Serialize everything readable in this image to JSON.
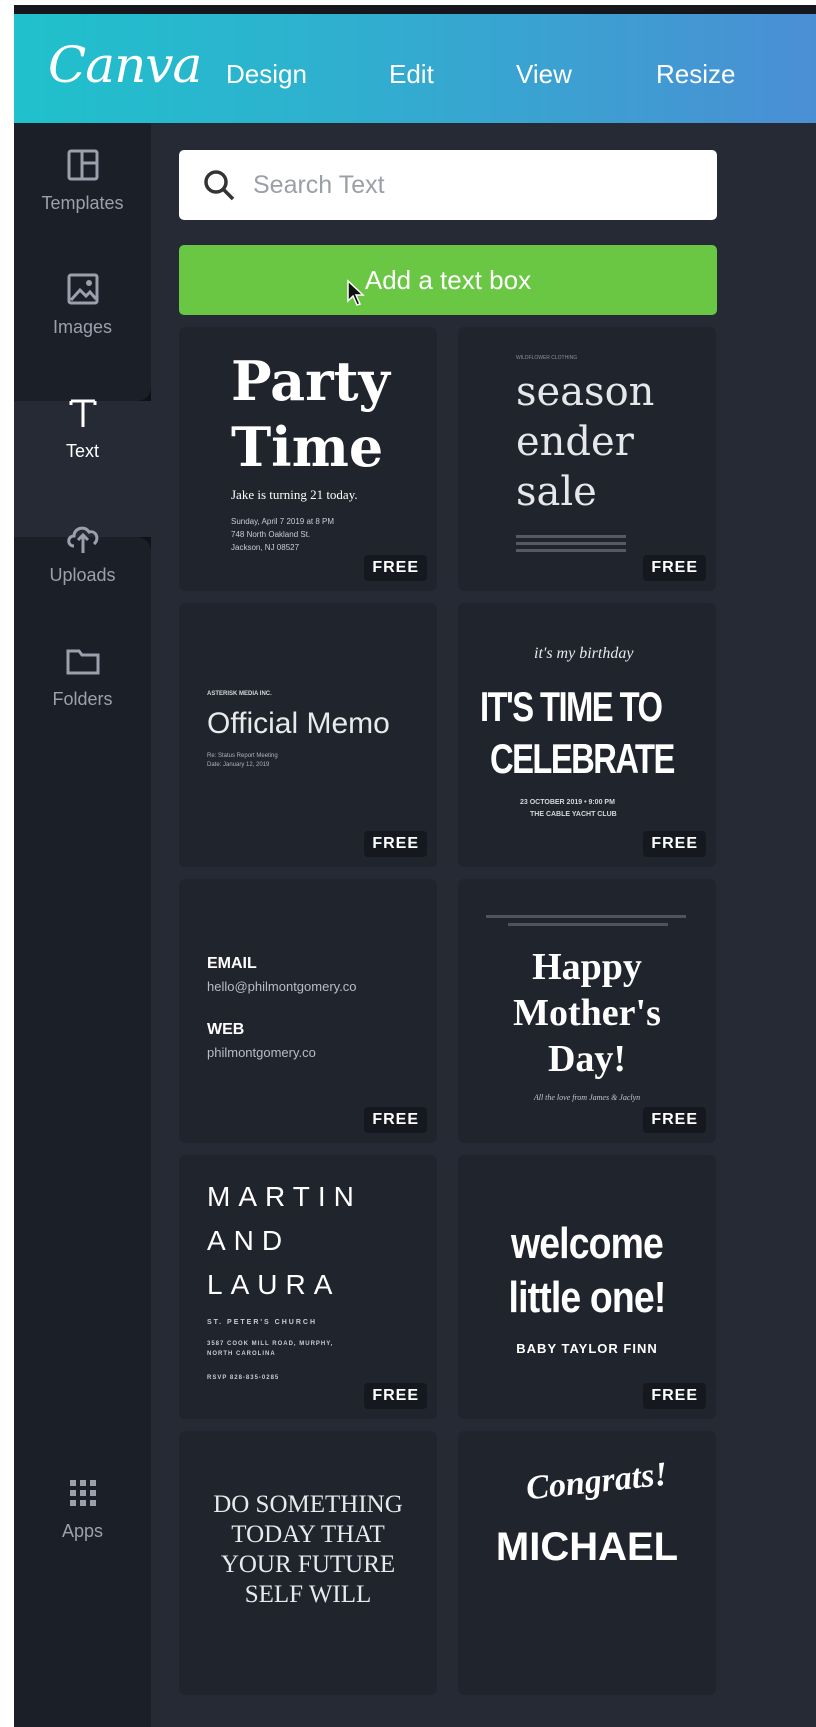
{
  "app": {
    "logo": "Canva",
    "menu": [
      "Design",
      "Edit",
      "View",
      "Resize"
    ]
  },
  "sidebar": {
    "items": [
      {
        "label": "Templates",
        "icon": "templates-icon"
      },
      {
        "label": "Images",
        "icon": "images-icon"
      },
      {
        "label": "Text",
        "icon": "text-icon",
        "active": true
      },
      {
        "label": "Uploads",
        "icon": "upload-cloud-icon"
      },
      {
        "label": "Folders",
        "icon": "folder-icon"
      },
      {
        "label": "Apps",
        "icon": "apps-grid-icon"
      }
    ]
  },
  "search": {
    "placeholder": "Search Text",
    "value": ""
  },
  "add_text_box": "Add a text box",
  "badge": "FREE",
  "cards": {
    "party": {
      "line1": "Party",
      "line2": "Time",
      "sub": "Jake is turning 21 today.",
      "d1": "Sunday, April 7 2019 at 8 PM",
      "d2": "748 North Oakland St.",
      "d3": "Jackson, NJ 08527"
    },
    "season": {
      "top": "WILDFLOWER CLOTHING",
      "l1": "season",
      "l2": "ender",
      "l3": "sale"
    },
    "memo": {
      "top": "ASTERISK MEDIA INC.",
      "title": "Official Memo",
      "s1": "Re: Status Report Meeting",
      "s2": "Date: January 12, 2019"
    },
    "celebrate": {
      "script": "it's my birthday",
      "l1": "IT'S TIME TO",
      "l2": "CELEBRATE",
      "s1": "23 OCTOBER 2019 • 9:00 PM",
      "s2": "THE CABLE YACHT CLUB"
    },
    "contact": {
      "h1": "EMAIL",
      "v1": "hello@philmontgomery.co",
      "h2": "WEB",
      "v2": "philmontgomery.co"
    },
    "mothers": {
      "l1": "Happy",
      "l2": "Mother's",
      "l3": "Day!",
      "sub": "All the love from James & Jaclyn"
    },
    "martin": {
      "l1": "MARTIN",
      "l2": "AND",
      "l3": "LAURA",
      "s1": "ST. PETER'S CHURCH",
      "s2": "3587 COOK MILL ROAD, MURPHY,",
      "s3": "NORTH CAROLINA",
      "s4": "RSVP 828-835-0285"
    },
    "welcome": {
      "l1": "welcome",
      "l2": "little one!",
      "sub": "BABY TAYLOR FINN"
    },
    "dosomething": {
      "l1": "DO SOMETHING",
      "l2": "TODAY THAT",
      "l3": "YOUR FUTURE",
      "l4": "SELF WILL"
    },
    "congrats": {
      "l1": "Congrats!",
      "l2": "MICHAEL"
    }
  },
  "colors": {
    "accent_green": "#6ac744",
    "topbar_start": "#1fc1cc",
    "topbar_end": "#4a8fd4",
    "panel": "#252a34"
  }
}
